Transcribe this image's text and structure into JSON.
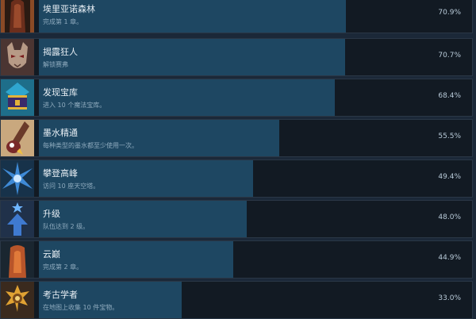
{
  "achievements": [
    {
      "title": "埃里亚诺森林",
      "description": "完成第 1 章。",
      "percent_label": "70.9%",
      "percent": 70.9,
      "icon": "brown-creature-icon"
    },
    {
      "title": "揭露狂人",
      "description": "解锁赛弗",
      "percent_label": "70.7%",
      "percent": 70.7,
      "icon": "masked-face-icon"
    },
    {
      "title": "发现宝库",
      "description": "进入 10 个魔法宝库。",
      "percent_label": "68.4%",
      "percent": 68.4,
      "icon": "treasure-chest-icon"
    },
    {
      "title": "墨水精通",
      "description": "每种类型的墨水都至少使用一次。",
      "percent_label": "55.5%",
      "percent": 55.5,
      "icon": "ink-quill-icon"
    },
    {
      "title": "攀登高峰",
      "description": "访问 10 座天空塔。",
      "percent_label": "49.4%",
      "percent": 49.4,
      "icon": "blue-burst-icon"
    },
    {
      "title": "升级",
      "description": "队伍达到 2 级。",
      "percent_label": "48.0%",
      "percent": 48.0,
      "icon": "level-up-arrow-icon"
    },
    {
      "title": "云巅",
      "description": "完成第 2 章。",
      "percent_label": "44.9%",
      "percent": 44.9,
      "icon": "orange-creature-icon"
    },
    {
      "title": "考古学者",
      "description": "在地图上收集 10 件宝物。",
      "percent_label": "33.0%",
      "percent": 33.0,
      "icon": "golden-relic-icon"
    }
  ]
}
